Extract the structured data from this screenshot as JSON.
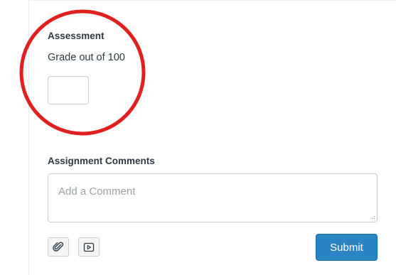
{
  "assessment": {
    "heading": "Assessment",
    "grade_label": "Grade out of 100",
    "grade_value": ""
  },
  "comments": {
    "heading": "Assignment Comments",
    "placeholder": "Add a Comment",
    "value": ""
  },
  "toolbar": {
    "attach_icon": "paperclip-icon",
    "media_icon": "media-play-icon",
    "submit_label": "Submit"
  },
  "colors": {
    "highlight_circle": "#e0201f",
    "submit_bg": "#2b83c4",
    "text": "#2d3b45"
  }
}
